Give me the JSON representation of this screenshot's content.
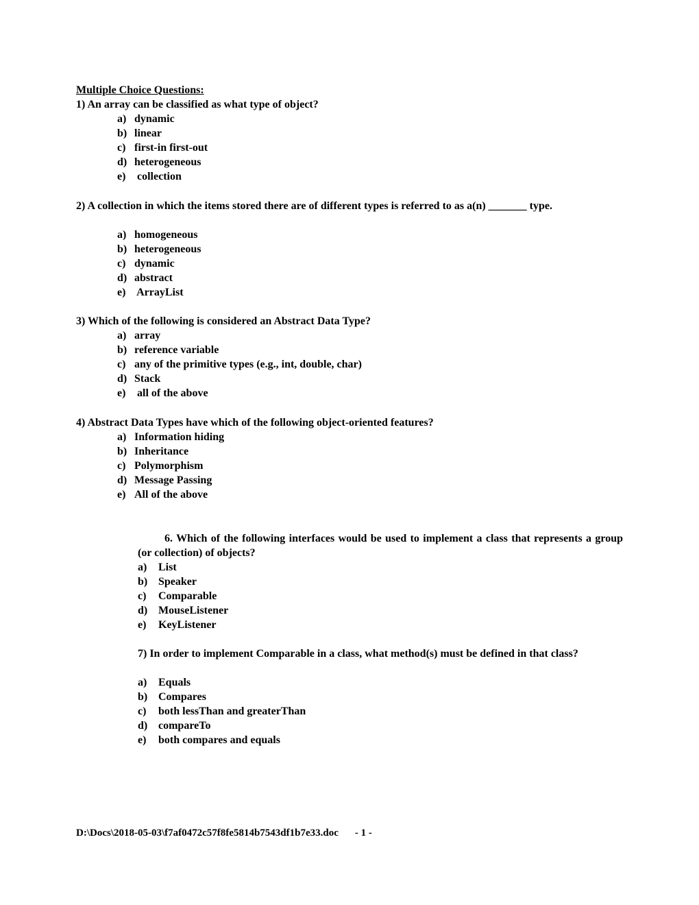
{
  "heading": "Multiple Choice Questions:",
  "questions": [
    {
      "prompt": "1)  An array can be classified as what type of object?",
      "options": [
        {
          "label": "a)",
          "text": "dynamic"
        },
        {
          "label": "b)",
          "text": "linear"
        },
        {
          "label": "c)",
          "text": "first-in first-out"
        },
        {
          "label": "d)",
          "text": "heterogeneous"
        },
        {
          "label": "e)",
          "text": " collection"
        }
      ]
    },
    {
      "prompt": "2)  A collection in which the items stored there are of different types is referred to as a(n) _______ type.",
      "options": [
        {
          "label": "a)",
          "text": "homogeneous"
        },
        {
          "label": "b)",
          "text": "heterogeneous"
        },
        {
          "label": "c)",
          "text": "dynamic"
        },
        {
          "label": "d)",
          "text": "abstract"
        },
        {
          "label": "e)",
          "text": " ArrayList"
        }
      ]
    },
    {
      "prompt": "3)  Which of the following is considered an Abstract Data Type?",
      "options": [
        {
          "label": "a)",
          "text": "array"
        },
        {
          "label": "b)",
          "text": "reference variable"
        },
        {
          "label": "c)",
          "text": "any of the primitive types (e.g., int, double, char)"
        },
        {
          "label": "d)",
          "text": "Stack"
        },
        {
          "label": "e)",
          "text": " all of the above"
        }
      ]
    },
    {
      "prompt": "4)  Abstract Data Types have which of the following object-oriented features?",
      "options": [
        {
          "label": "a)",
          "text": "Information hiding"
        },
        {
          "label": "b)",
          "text": "Inheritance"
        },
        {
          "label": "c)",
          "text": "Polymorphism"
        },
        {
          "label": "d)",
          "text": "Message Passing"
        },
        {
          "label": "e)",
          "text": "All of the above"
        }
      ]
    },
    {
      "prompt": "6. Which of the following interfaces would be used to implement a class that represents a group (or collection) of objects?",
      "options": [
        {
          "label": "a)",
          "text": "List"
        },
        {
          "label": "b)",
          "text": "Speaker"
        },
        {
          "label": "c)",
          "text": "Comparable"
        },
        {
          "label": "d)",
          "text": "MouseListener"
        },
        {
          "label": "e)",
          "text": "KeyListener"
        }
      ]
    },
    {
      "prompt": "7) In order to implement Comparable in a class, what method(s) must be defined in that class?",
      "options": [
        {
          "label": "a)",
          "text": "Equals"
        },
        {
          "label": "b)",
          "text": "Compares"
        },
        {
          "label": "c)",
          "text": "both lessThan and greaterThan"
        },
        {
          "label": "d)",
          "text": "compareTo"
        },
        {
          "label": "e)",
          "text": "both compares and equals"
        }
      ]
    }
  ],
  "footer": {
    "path": "D:\\Docs\\2018-05-03\\f7af0472c57f8fe5814b7543df1b7e33.doc",
    "page": "- 1 -"
  }
}
